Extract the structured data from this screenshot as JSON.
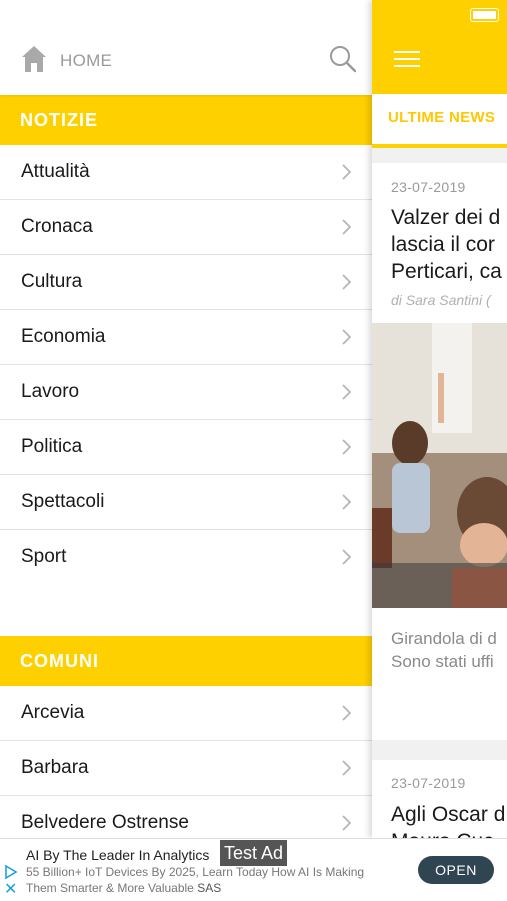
{
  "menu": {
    "home_label": "HOME",
    "section_news": "NOTIZIE",
    "news_items": [
      "Attualità",
      "Cronaca",
      "Cultura",
      "Economia",
      "Lavoro",
      "Politica",
      "Spettacoli",
      "Sport"
    ],
    "section_towns": "COMUNI",
    "town_items": [
      "Arcevia",
      "Barbara",
      "Belvedere Ostrense"
    ]
  },
  "content": {
    "tab_label": "ULTIME NEWS",
    "article1": {
      "date": "23-07-2019",
      "title_lines": [
        "Valzer dei d",
        "lascia il cor",
        "Perticari, ca"
      ],
      "author": "di Sara Santini (",
      "excerpt_lines": [
        "Girandola di d",
        "Sono stati uffi"
      ]
    },
    "article2": {
      "date": "23-07-2019",
      "title_lines": [
        "Agli Oscar d",
        "Mauro Cuc"
      ]
    }
  },
  "ad": {
    "title": "AI By The Leader In Analytics",
    "tag": "Test Ad",
    "text": "55 Billion+ IoT Devices By 2025, Learn Today How AI Is Making Them Smarter & More Valuable",
    "brand": "SAS",
    "open_label": "OPEN"
  },
  "colors": {
    "accent": "#ffd000",
    "tab_text": "#ffc800",
    "ad_button": "#2f4552"
  },
  "icons": [
    "home-icon",
    "search-icon",
    "chevron-right-icon",
    "hamburger-icon",
    "battery-icon",
    "ad-choices-icon",
    "close-icon"
  ]
}
